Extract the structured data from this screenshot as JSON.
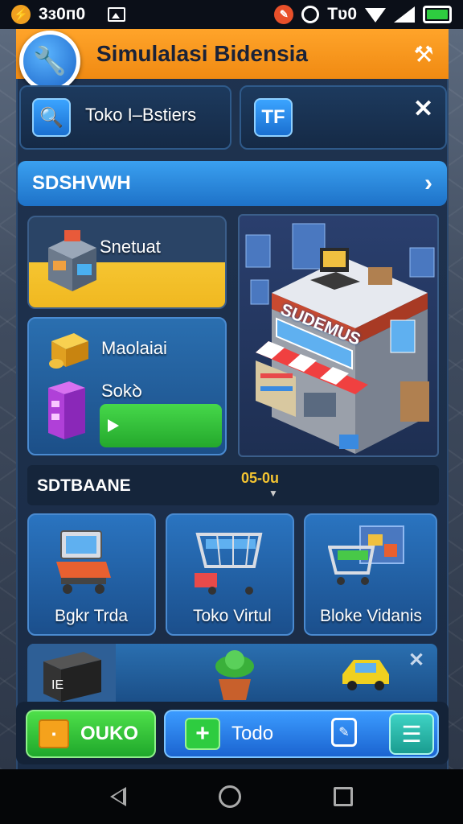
{
  "status_bar": {
    "time": "3ɜ0п0",
    "right_text": "Tʋ0",
    "icons": [
      "bolt-icon",
      "image-icon",
      "record-icon",
      "clock-icon",
      "wifi-icon",
      "signal-icon",
      "battery-icon"
    ],
    "battery_color": "#2ecc40"
  },
  "title_bar": {
    "title": "Simulalasi Bidensia",
    "color": "#f39618",
    "tool_icon": "wrench-screwdriver-icon"
  },
  "top_cards": {
    "left": {
      "icon": "magnifier-icon",
      "label": "Toko I–Bstiers"
    },
    "right": {
      "icon": "tf-icon",
      "glyph": "TF"
    }
  },
  "section_bar": {
    "label": "SDSHVWH"
  },
  "tiles": {
    "shop_card": {
      "label": "Snetuat"
    },
    "goods_card": {
      "label_top": "Maolaiai",
      "label_bottom": "Sokꝺ"
    },
    "store_sign": "SUDEMUS"
  },
  "subsection": {
    "label": "SDTBAANE",
    "value": "05-0u"
  },
  "items": [
    {
      "label": "Bgkr Trda",
      "icon": "laptop-cart-icon"
    },
    {
      "label": "Toko Virtul",
      "icon": "shopping-cart-icon"
    },
    {
      "label": "Bloke Vidanis",
      "icon": "cart-store-icon"
    }
  ],
  "bottom_actions": {
    "primary": {
      "label": "OUKO",
      "icon": "box-icon",
      "color": "#2ecc40"
    },
    "secondary": {
      "label": "Todo",
      "icon": "plus-icon",
      "color": "#2a82ea"
    }
  }
}
